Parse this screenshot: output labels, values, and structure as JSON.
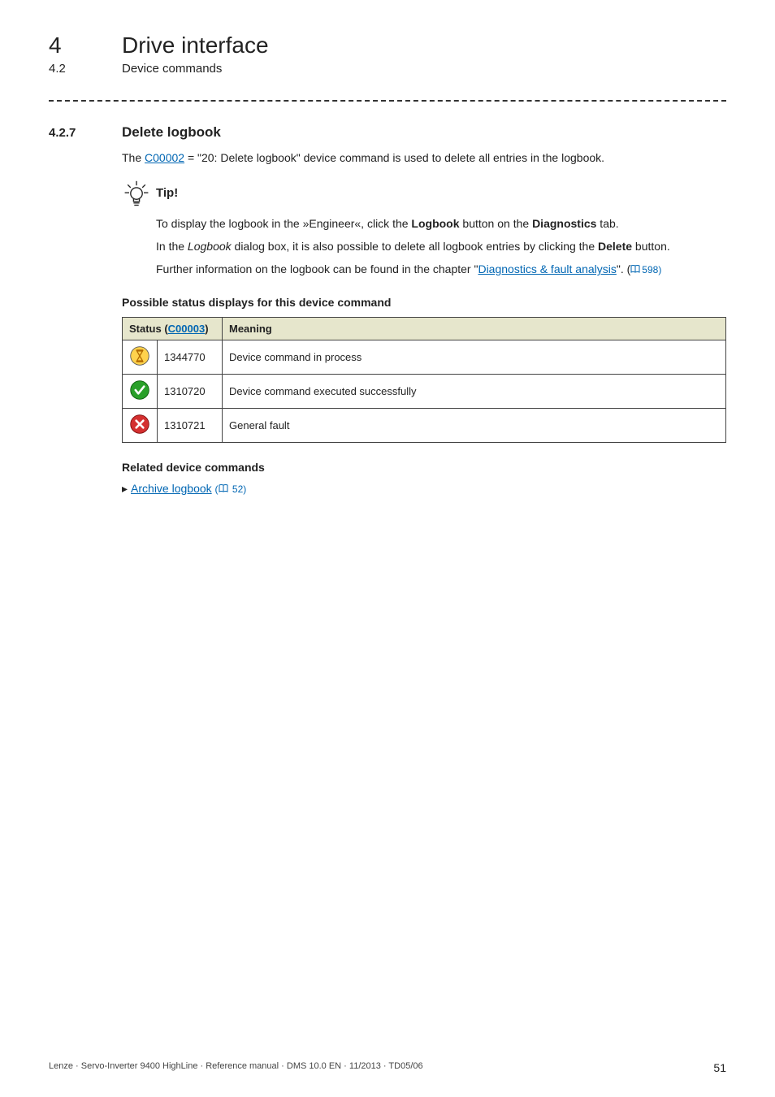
{
  "header": {
    "chapter_number": "4",
    "chapter_title": "Drive interface",
    "section_number": "4.2",
    "section_title": "Device commands"
  },
  "section": {
    "number": "4.2.7",
    "title": "Delete logbook"
  },
  "intro": {
    "prefix": "The ",
    "link": "C00002",
    "suffix": " = \"20: Delete logbook\" device command is used to delete all entries in the logbook."
  },
  "tip": {
    "label": "Tip!",
    "line1_a": "To display the logbook in the »Engineer«, click the ",
    "line1_bold1": "Logbook",
    "line1_b": " button on the ",
    "line1_bold2": "Diagnostics",
    "line1_c": " tab.",
    "line2_a": "In the ",
    "line2_italic": "Logbook",
    "line2_b": " dialog box, it is also possible to delete all logbook entries by clicking the ",
    "line2_bold": "Delete",
    "line2_c": " button.",
    "line3_a": "Further information on the logbook can be found in the chapter \"",
    "line3_link": "Diagnostics & fault analysis",
    "line3_b": "\".  (",
    "line3_page": "598",
    "line3_c": ")"
  },
  "status_heading": "Possible status displays for this device command",
  "table": {
    "col1_a": "Status (",
    "col1_link": "C00003",
    "col1_b": ")",
    "col2": "Meaning",
    "rows": [
      {
        "code": "1344770",
        "meaning": "Device command in process",
        "icon": "hourglass"
      },
      {
        "code": "1310720",
        "meaning": "Device command executed successfully",
        "icon": "check"
      },
      {
        "code": "1310721",
        "meaning": "General fault",
        "icon": "cross"
      }
    ]
  },
  "related": {
    "heading": "Related device commands",
    "item_link": "Archive logbook",
    "item_page": "52"
  },
  "footer": {
    "left": "Lenze · Servo-Inverter 9400 HighLine · Reference manual · DMS 10.0 EN · 11/2013 · TD05/06",
    "page": "51"
  }
}
